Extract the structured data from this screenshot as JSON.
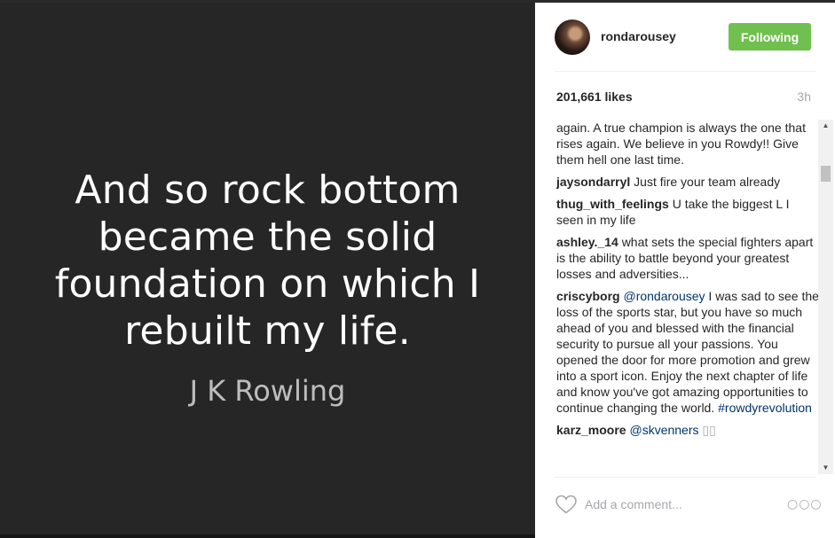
{
  "post": {
    "quote": "And so rock bottom became the solid foundation on which I rebuilt my life.",
    "quote_lines": [
      "And so rock bottom",
      "became the solid",
      "foundation on which I",
      "rebuilt my life."
    ],
    "author": "J K Rowling"
  },
  "header": {
    "username": "rondarousey",
    "follow_label": "Following"
  },
  "meta": {
    "likes": "201,661 likes",
    "time": "3h"
  },
  "comments": [
    {
      "user": "",
      "text": "again. A true champion is always the one that rises again. We believe in you Rowdy!! Give them hell one last time.",
      "mention": "",
      "tag": ""
    },
    {
      "user": "jaysondarryl",
      "text": "Just fire your team already",
      "mention": "",
      "tag": ""
    },
    {
      "user": "thug_with_feelings",
      "text": "U take the biggest L I seen in my life",
      "mention": "",
      "tag": ""
    },
    {
      "user": "ashley._14",
      "text": "what sets the special fighters apart is the ability to battle beyond your greatest losses and adversities...",
      "mention": "",
      "tag": ""
    },
    {
      "user": "criscyborg",
      "mention": "@rondarousey",
      "text": "I was sad to see the loss of the sports star, but you have so much ahead of you and blessed with the financial security to pursue all your passions. You opened the door for more promotion and grew into a sport icon. Enjoy the next chapter of life and know you've got amazing opportunities to continue changing the world.",
      "tag": "#rowdyrevolution"
    },
    {
      "user": "karz_moore",
      "mention": "@skvenners",
      "text": "▯▯",
      "tag": ""
    }
  ],
  "comment_box": {
    "placeholder": "Add a comment..."
  },
  "icons": {
    "heart": "heart-outline-icon",
    "more": "more-options-icon",
    "scroll_up": "▲",
    "scroll_down": "▼",
    "more_glyph": "○○○"
  },
  "colors": {
    "follow_button": "#70c050",
    "link": "#003569",
    "image_background": "#262626"
  }
}
